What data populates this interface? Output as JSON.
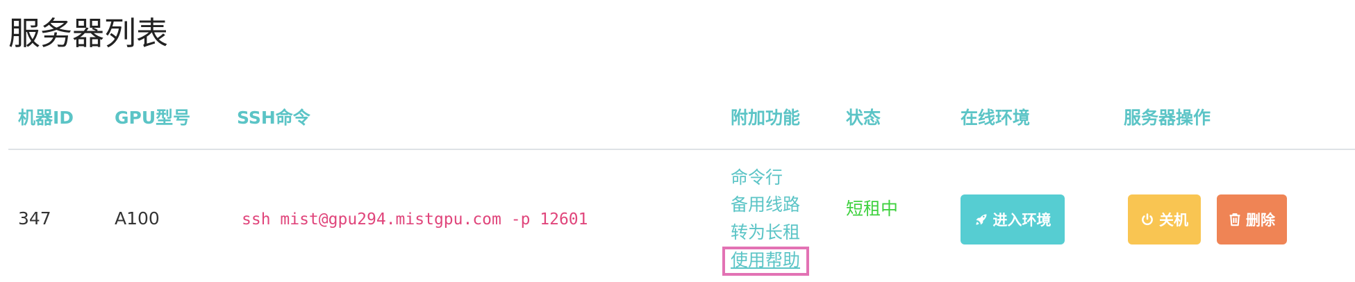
{
  "page": {
    "title": "服务器列表"
  },
  "table": {
    "headers": {
      "machine_id": "机器ID",
      "gpu_model": "GPU型号",
      "ssh_command": "SSH命令",
      "extras": "附加功能",
      "status": "状态",
      "online_env": "在线环境",
      "server_ops": "服务器操作"
    },
    "rows": [
      {
        "machine_id": "347",
        "gpu_model": "A100",
        "ssh_command": "ssh mist@gpu294.mistgpu.com -p 12601",
        "extras": {
          "command_line": "命令行",
          "backup_route": "备用线路",
          "to_long_term": "转为长租",
          "help": "使用帮助"
        },
        "status": "短租中",
        "enter_env_label": "进入环境",
        "shutdown_label": "关机",
        "delete_label": "删除"
      }
    ]
  },
  "icons": {
    "enter_env": "rocket-icon",
    "shutdown": "power-icon",
    "delete": "trash-icon"
  },
  "colors": {
    "header_text": "#5bc4c6",
    "link": "#5bc4c6",
    "ssh_text": "#e0457b",
    "status_text": "#3fd13f",
    "enter_button": "#56cdd2",
    "shutdown_button": "#f9c552",
    "delete_button": "#ef8455",
    "highlight_box": "#e272b4"
  }
}
